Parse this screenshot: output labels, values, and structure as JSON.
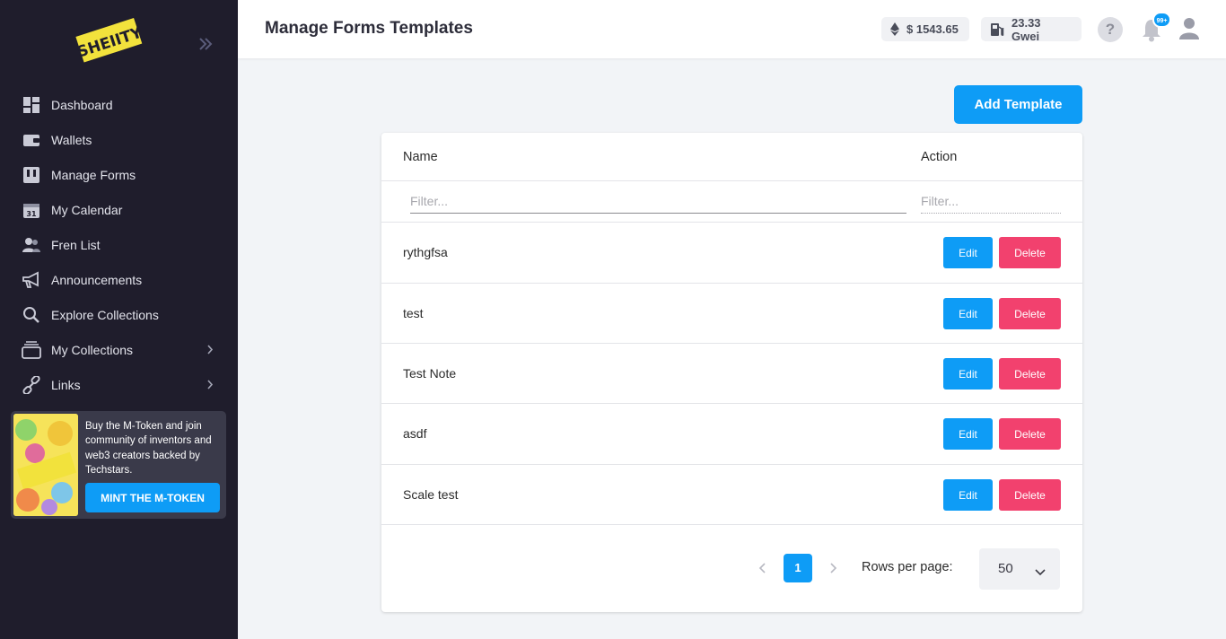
{
  "sidebar": {
    "logo_text": "SHEIITY",
    "items": [
      {
        "label": "Dashboard",
        "icon": "dashboard-icon"
      },
      {
        "label": "Wallets",
        "icon": "wallet-icon"
      },
      {
        "label": "Manage Forms",
        "icon": "forms-icon"
      },
      {
        "label": "My Calendar",
        "icon": "calendar-icon",
        "icon_text": "31"
      },
      {
        "label": "Fren List",
        "icon": "users-icon"
      },
      {
        "label": "Announcements",
        "icon": "megaphone-icon"
      },
      {
        "label": "Explore Collections",
        "icon": "search-icon"
      },
      {
        "label": "My Collections",
        "icon": "collection-icon"
      },
      {
        "label": "Links",
        "icon": "link-icon"
      }
    ],
    "promo": {
      "text": "Buy the M-Token and join community of inventors and web3 creators backed by Techstars.",
      "button_label": "MINT THE M-TOKEN"
    }
  },
  "header": {
    "title": "Manage Forms Templates",
    "eth_price": "$ 1543.65",
    "gas_price": "23.33 Gwei",
    "help_label": "?",
    "notification_badge": "99+"
  },
  "main": {
    "add_button_label": "Add Template",
    "table": {
      "columns": [
        "Name",
        "Action"
      ],
      "filter_placeholder": "Filter...",
      "rows": [
        {
          "name": "rythgfsa"
        },
        {
          "name": "test"
        },
        {
          "name": "Test Note"
        },
        {
          "name": "asdf"
        },
        {
          "name": "Scale test"
        }
      ],
      "edit_label": "Edit",
      "delete_label": "Delete"
    },
    "pagination": {
      "current_page": "1",
      "rows_per_page_label": "Rows per page:",
      "rows_per_page_value": "50"
    }
  },
  "colors": {
    "sidebar_bg": "#1f1d2c",
    "accent": "#0e9cf6",
    "danger": "#f2416e",
    "logo_yellow": "#f2e23c"
  }
}
